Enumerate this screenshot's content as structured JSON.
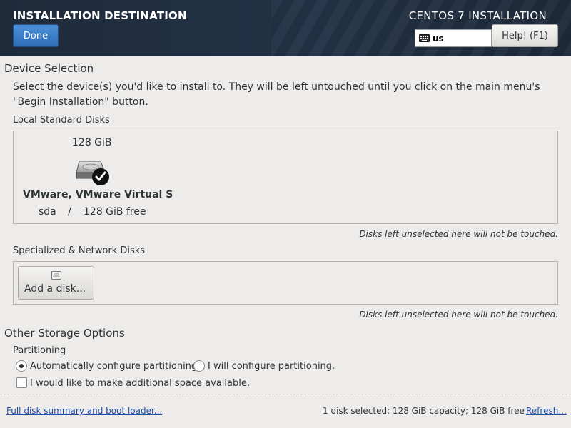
{
  "header": {
    "title": "INSTALLATION DESTINATION",
    "done_label": "Done",
    "product": "CENTOS 7 INSTALLATION",
    "keyboard_layout": "us",
    "help_label": "Help! (F1)"
  },
  "device_selection": {
    "heading": "Device Selection",
    "instruction_line1": "Select the device(s) you'd like to install to.  They will be left untouched until you click on the main menu's",
    "instruction_line2": "\"Begin Installation\" button."
  },
  "local_disks": {
    "heading": "Local Standard Disks",
    "disks": [
      {
        "size": "128 GiB",
        "name": "VMware, VMware Virtual S",
        "device": "sda",
        "separator": "/",
        "free": "128 GiB free",
        "selected": true
      }
    ],
    "note": "Disks left unselected here will not be touched."
  },
  "specialized": {
    "heading": "Specialized & Network Disks",
    "add_disk_label": "Add a disk...",
    "note": "Disks left unselected here will not be touched."
  },
  "other_storage": {
    "heading": "Other Storage Options",
    "partitioning_heading": "Partitioning",
    "auto_label": "Automatically configure partitioning.",
    "manual_label": "I will configure partitioning.",
    "selected_option": "auto",
    "additional_space_label": "I would like to make additional space available.",
    "additional_space_checked": false
  },
  "footer": {
    "summary_link": "Full disk summary and boot loader...",
    "status": "1 disk selected; 128 GiB capacity; 128 GiB free",
    "refresh_link": "Refresh..."
  },
  "colors": {
    "header_bg": "#223246",
    "accent": "#2f6fb8",
    "link": "#1e4fa3"
  }
}
